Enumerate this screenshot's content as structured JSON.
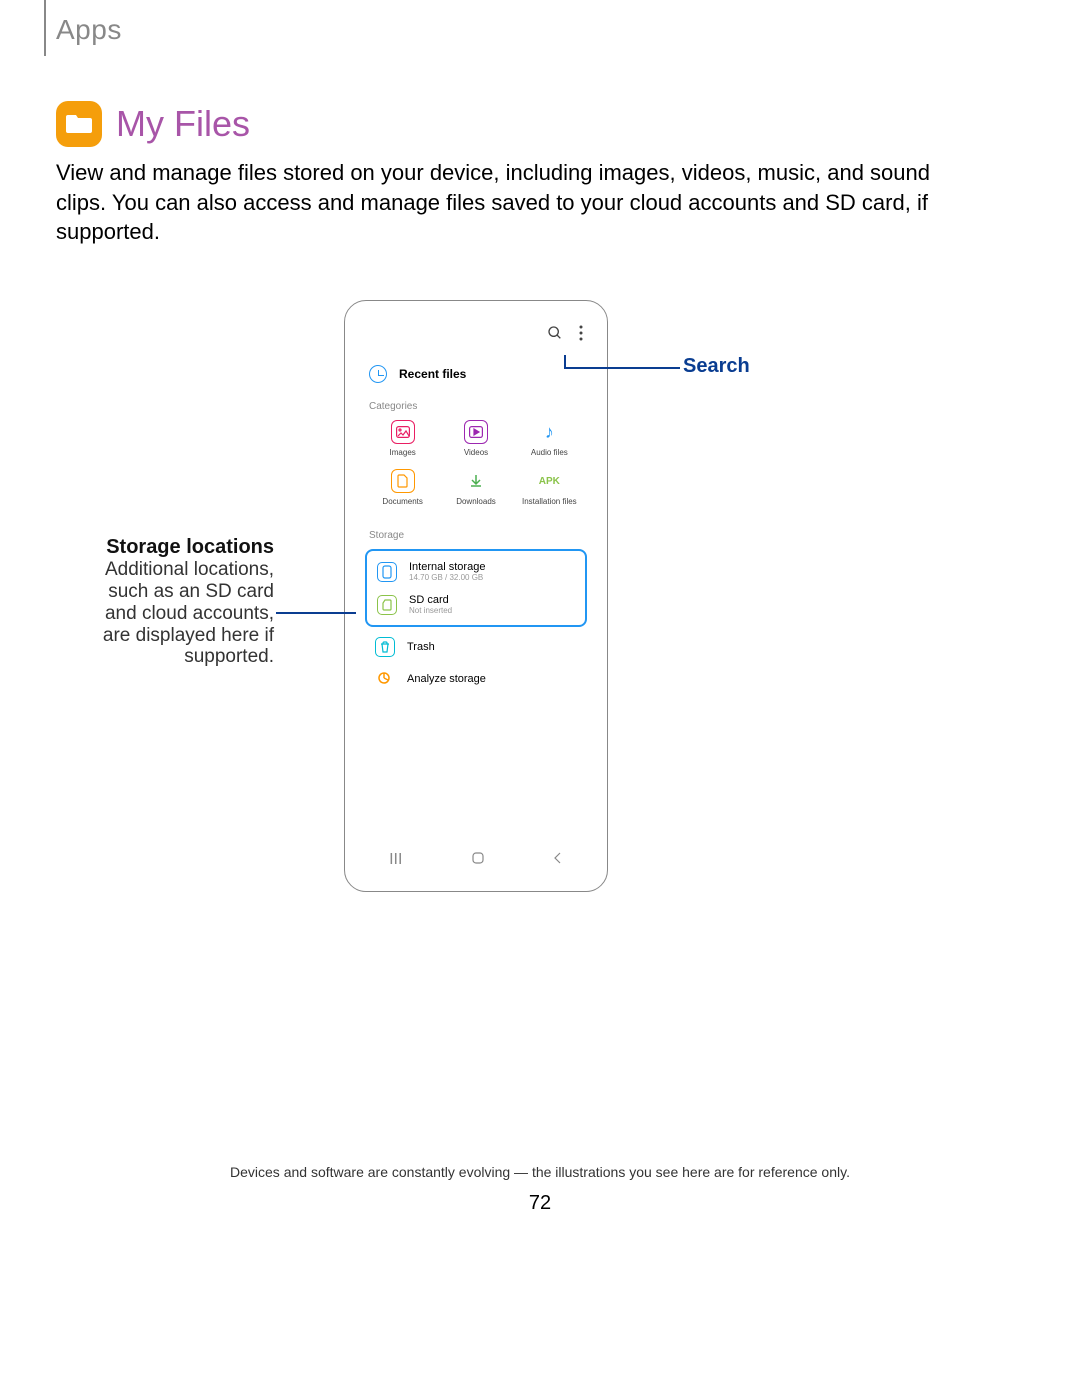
{
  "breadcrumb": "Apps",
  "title": "My Files",
  "description": "View and manage files stored on your device, including images, videos, music, and sound clips. You can also access and manage files saved to your cloud accounts and SD card, if supported.",
  "callouts": {
    "search": "Search",
    "storage_title": "Storage locations",
    "storage_text": "Additional locations, such as an SD card and cloud accounts, are displayed here if supported."
  },
  "phone": {
    "recent": "Recent files",
    "categories_header": "Categories",
    "categories": [
      {
        "label": "Images"
      },
      {
        "label": "Videos"
      },
      {
        "label": "Audio files"
      },
      {
        "label": "Documents"
      },
      {
        "label": "Downloads"
      },
      {
        "label": "Installation files"
      }
    ],
    "storage_header": "Storage",
    "storage": [
      {
        "title": "Internal storage",
        "sub": "14.70 GB / 32.00 GB"
      },
      {
        "title": "SD card",
        "sub": "Not inserted"
      }
    ],
    "trash": "Trash",
    "analyze": "Analyze storage",
    "apk": "APK"
  },
  "footer": "Devices and software are constantly evolving — the illustrations you see here are for reference only.",
  "page": "72"
}
